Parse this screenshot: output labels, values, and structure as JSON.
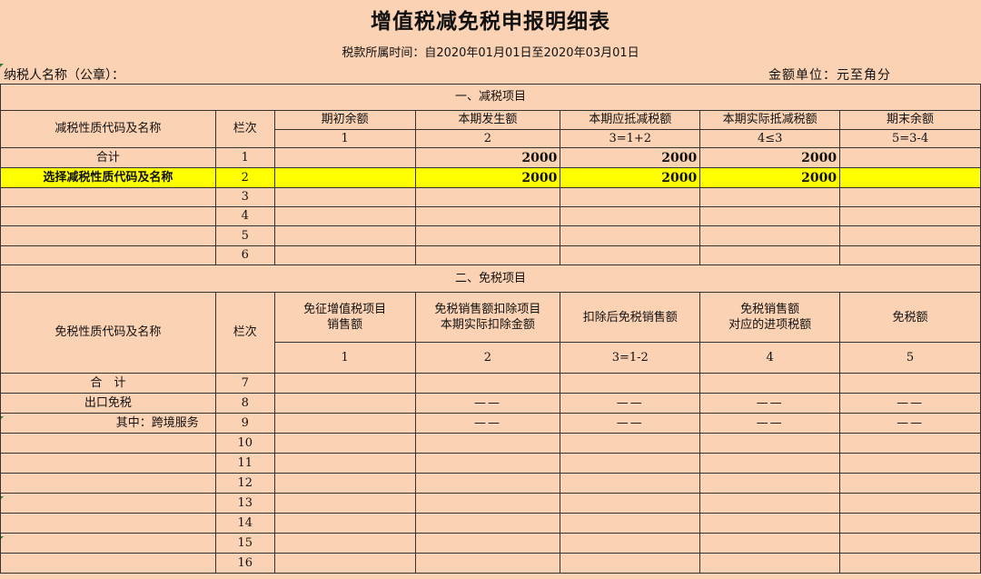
{
  "title": "增值税减免税申报明细表",
  "period": "税款所属时间：自2020年01月01日至2020年03月01日",
  "taxpayer_label": "纳税人名称（公章）：",
  "unit_label": "金额单位：元至角分",
  "section1": {
    "heading": "一、减税项目",
    "name_header": "减税性质代码及名称",
    "col_header": "栏次",
    "columns": [
      "期初余额",
      "本期发生额",
      "本期应抵减税额",
      "本期实际抵减税额",
      "期末余额"
    ],
    "column_numbers": [
      "1",
      "2",
      "3=1+2",
      "4≤3",
      "5=3-4"
    ],
    "rows": [
      {
        "name": "合计",
        "no": "1",
        "values": [
          "",
          "2000",
          "2000",
          "2000",
          ""
        ]
      },
      {
        "name": "选择减税性质代码及名称",
        "no": "2",
        "values": [
          "",
          "2000",
          "2000",
          "2000",
          ""
        ]
      },
      {
        "name": "",
        "no": "3",
        "values": [
          "",
          "",
          "",
          "",
          ""
        ]
      },
      {
        "name": "",
        "no": "4",
        "values": [
          "",
          "",
          "",
          "",
          ""
        ]
      },
      {
        "name": "",
        "no": "5",
        "values": [
          "",
          "",
          "",
          "",
          ""
        ]
      },
      {
        "name": "",
        "no": "6",
        "values": [
          "",
          "",
          "",
          "",
          ""
        ]
      }
    ]
  },
  "section2": {
    "heading": "二、免税项目",
    "name_header": "免税性质代码及名称",
    "col_header": "栏次",
    "columns": [
      [
        "免征增值税项目",
        "销售额"
      ],
      [
        "免税销售额扣除项目",
        "本期实际扣除金额"
      ],
      [
        "扣除后免税销售额"
      ],
      [
        "免税销售额",
        "对应的进项税额"
      ],
      [
        "免税额"
      ]
    ],
    "column_numbers": [
      "1",
      "2",
      "3=1-2",
      "4",
      "5"
    ],
    "rows": [
      {
        "name": "合　计",
        "no": "7",
        "values": [
          "",
          "",
          "",
          "",
          ""
        ]
      },
      {
        "name": "出口免税",
        "no": "8",
        "values": [
          "",
          "——",
          "——",
          "——",
          "——"
        ]
      },
      {
        "name": "其中：跨境服务",
        "no": "9",
        "values": [
          "",
          "——",
          "——",
          "——",
          "——"
        ]
      },
      {
        "name": "",
        "no": "10",
        "values": [
          "",
          "",
          "",
          "",
          ""
        ]
      },
      {
        "name": "",
        "no": "11",
        "values": [
          "",
          "",
          "",
          "",
          ""
        ]
      },
      {
        "name": "",
        "no": "12",
        "values": [
          "",
          "",
          "",
          "",
          ""
        ]
      },
      {
        "name": "",
        "no": "13",
        "values": [
          "",
          "",
          "",
          "",
          ""
        ]
      },
      {
        "name": "",
        "no": "14",
        "values": [
          "",
          "",
          "",
          "",
          ""
        ]
      },
      {
        "name": "",
        "no": "15",
        "values": [
          "",
          "",
          "",
          "",
          ""
        ]
      },
      {
        "name": "",
        "no": "16",
        "values": [
          "",
          "",
          "",
          "",
          ""
        ]
      }
    ]
  },
  "colors": {
    "background": "#fbd2b4",
    "highlight": "#ffff00"
  }
}
